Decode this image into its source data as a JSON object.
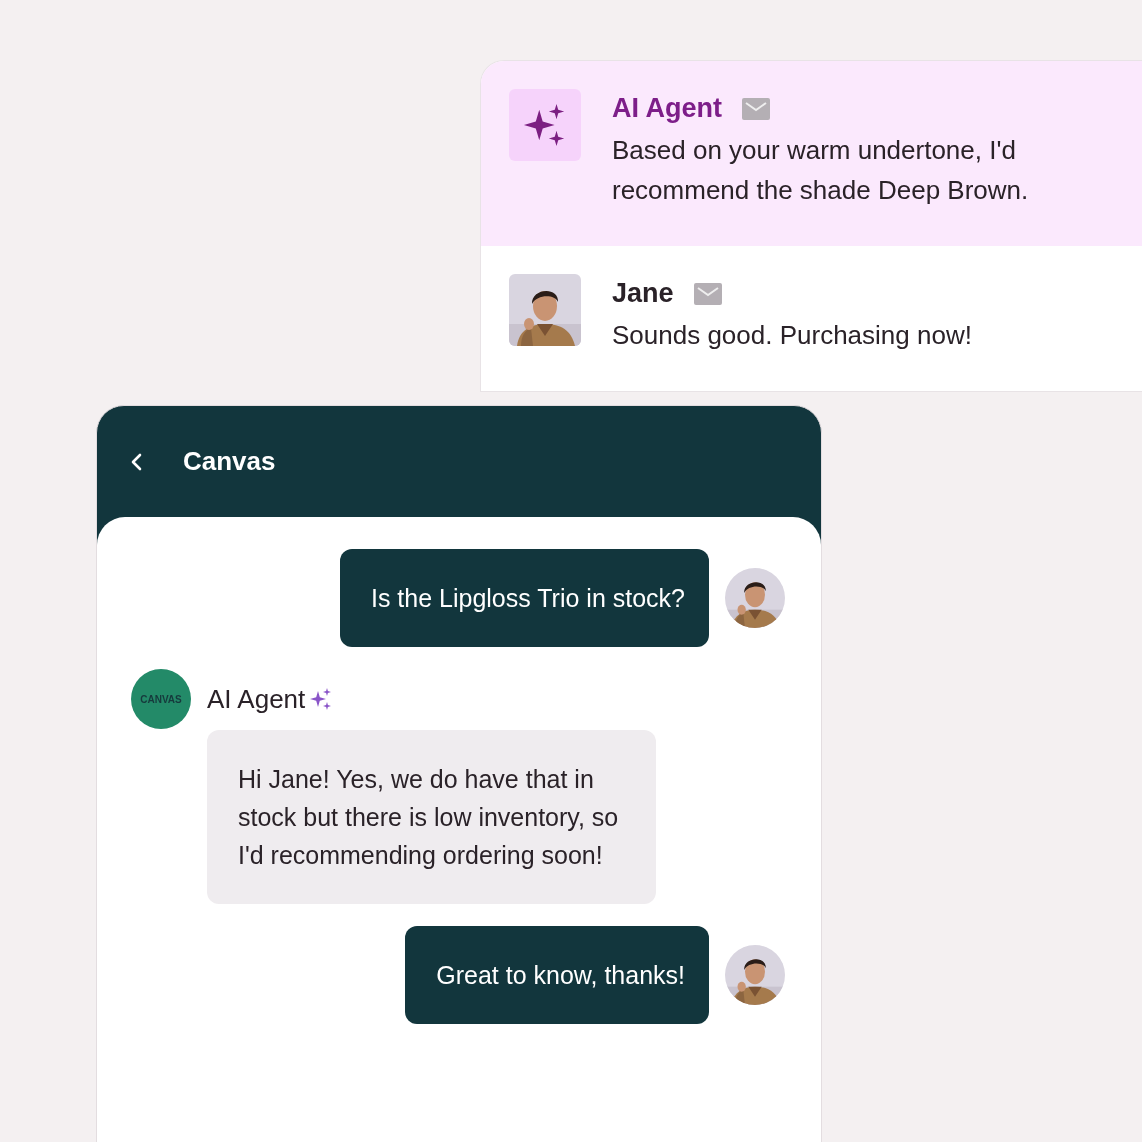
{
  "inbox": [
    {
      "kind": "agent",
      "sender": "AI Agent",
      "message": "Based on your warm undertone, I'd recommend the shade Deep Brown.",
      "highlighted": true
    },
    {
      "kind": "person",
      "sender": "Jane",
      "message": "Sounds good. Purchasing now!",
      "highlighted": false
    }
  ],
  "chat": {
    "title": "Canvas",
    "messages": [
      {
        "kind": "user",
        "text": "Is the Lipgloss Trio in stock?"
      },
      {
        "kind": "agent",
        "sender": "AI Agent",
        "logo": "CANVAS",
        "text": "Hi Jane! Yes, we do have that in stock but there is low inventory, so I'd recommending ordering soon!"
      },
      {
        "kind": "user",
        "text": "Great to know, thanks!"
      }
    ]
  }
}
